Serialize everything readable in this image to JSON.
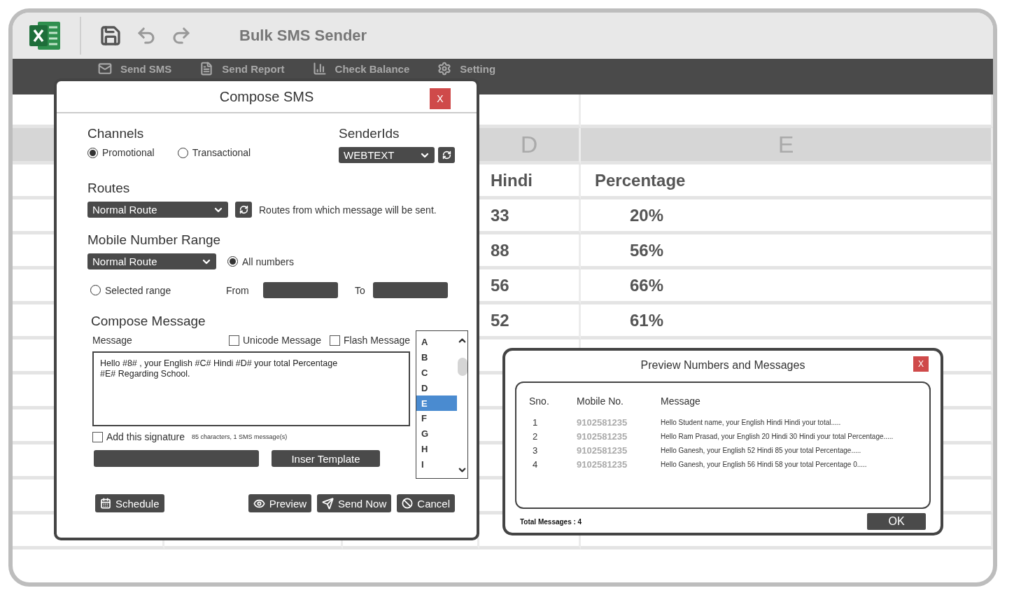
{
  "app": {
    "title": "Bulk SMS Sender",
    "ribbon": [
      {
        "label": "Send SMS",
        "kind": "envelope"
      },
      {
        "label": "Send Report",
        "kind": "report"
      },
      {
        "label": "Check Balance",
        "kind": "chart"
      },
      {
        "label": "Setting",
        "kind": "gear"
      }
    ]
  },
  "sheet": {
    "column_letters": [
      "D",
      "E"
    ],
    "header": [
      "Hindi",
      "Percentage"
    ],
    "rows": [
      [
        "33",
        "20%"
      ],
      [
        "88",
        "56%"
      ],
      [
        "56",
        "66%"
      ],
      [
        "52",
        "61%"
      ]
    ]
  },
  "compose": {
    "title": "Compose SMS",
    "close": "X",
    "channels": {
      "heading": "Channels",
      "options": [
        {
          "label": "Promotional",
          "selected": true
        },
        {
          "label": "Transactional",
          "selected": false
        }
      ]
    },
    "sender_ids": {
      "heading": "SenderIds",
      "value": "WEBTEXT"
    },
    "routes": {
      "heading": "Routes",
      "value": "Normal Route",
      "note": "Routes from which message will be sent."
    },
    "mobile_range": {
      "heading": "Mobile Number Range",
      "value": "Normal Route",
      "options": [
        {
          "label": "All numbers",
          "selected": true
        },
        {
          "label": "Selected range",
          "selected": false
        }
      ],
      "from_label": "From",
      "to_label": "To"
    },
    "compose_heading": "Compose Message",
    "message_label": "Message",
    "flags": [
      {
        "label": "Unicode Message",
        "checked": false
      },
      {
        "label": "Flash Message",
        "checked": false
      }
    ],
    "message": "Hello #8# , your English #C# Hindi #D# your total Percentage\n#E# Regarding School.",
    "signature": {
      "label": "Add this signature",
      "checked": false
    },
    "counter": "85 characters, 1 SMS message(s)",
    "insert_template": "Inser Template",
    "columns": [
      {
        "label": "A",
        "selected": false
      },
      {
        "label": "B",
        "selected": false
      },
      {
        "label": "C",
        "selected": false
      },
      {
        "label": "D",
        "selected": false
      },
      {
        "label": "E",
        "selected": true
      },
      {
        "label": "F",
        "selected": false
      },
      {
        "label": "G",
        "selected": false
      },
      {
        "label": "H",
        "selected": false
      },
      {
        "label": "I",
        "selected": false
      }
    ],
    "schedule": "Schedule",
    "actions": [
      {
        "label": "Preview",
        "kind": "preview"
      },
      {
        "label": "Send Now",
        "kind": "send"
      },
      {
        "label": "Cancel",
        "kind": "cancel"
      }
    ]
  },
  "preview": {
    "title": "Preview Numbers and Messages",
    "close": "X",
    "columns": [
      "Sno.",
      "Mobile No.",
      "Message"
    ],
    "rows": [
      {
        "sno": "1",
        "mobile": "9102581235",
        "message": "Hello Student name, your English Hindi Hindi your total....."
      },
      {
        "sno": "2",
        "mobile": "9102581235",
        "message": "Hello Ram Prasad, your English 20 Hindi 30 Hindi your total Percentage....."
      },
      {
        "sno": "3",
        "mobile": "9102581235",
        "message": "Hello Ganesh, your English 52  Hindi  85 your total Percentage....."
      },
      {
        "sno": "4",
        "mobile": "9102581235",
        "message": "Hello Ganesh, your English 56  Hindi  58 your total Percentage 0....."
      }
    ],
    "total": "Total Messages : 4",
    "ok": "OK"
  }
}
